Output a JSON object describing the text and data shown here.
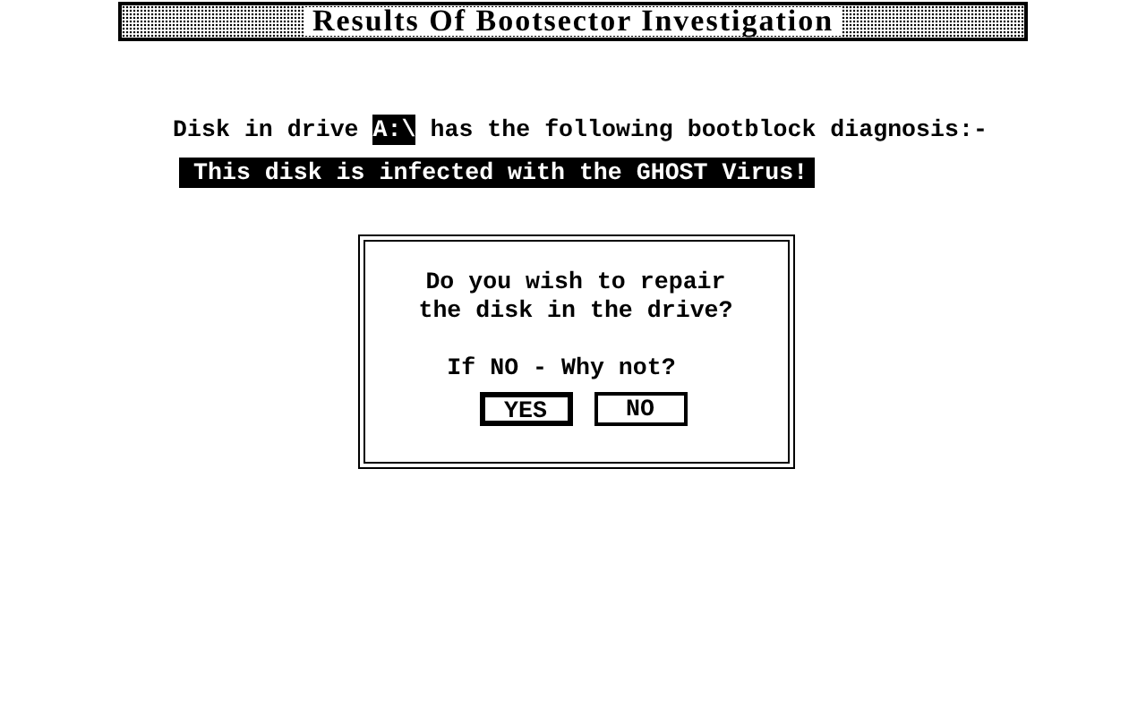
{
  "title_bar": {
    "title": "Results Of Bootsector Investigation"
  },
  "diagnosis": {
    "prefix": "Disk in drive",
    "drive": "A:\\",
    "suffix": "has the following bootblock diagnosis:-"
  },
  "result": "This disk is infected with the GHOST Virus!",
  "dialog": {
    "message": [
      "Do you wish to repair",
      "the disk in the drive?"
    ],
    "question": "If NO - Why not?",
    "buttons": [
      {
        "label": "YES",
        "default": true
      },
      {
        "label": "NO",
        "default": false
      }
    ]
  }
}
